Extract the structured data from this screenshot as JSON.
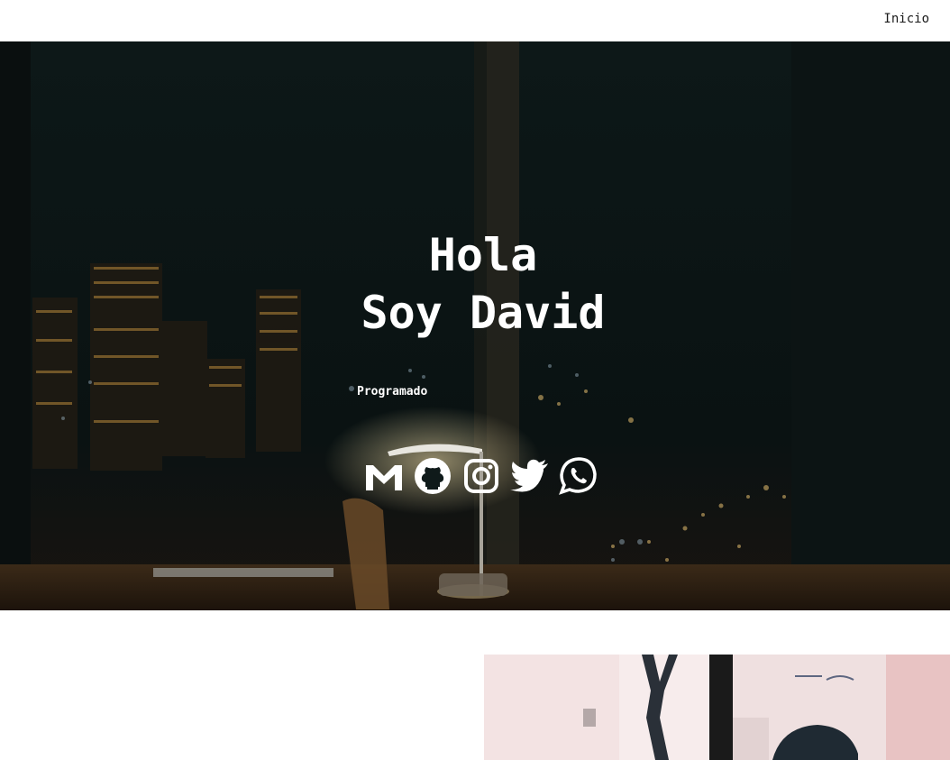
{
  "nav": {
    "home_label": "Inicio"
  },
  "hero": {
    "title_line1": "Hola",
    "title_line2": "Soy David",
    "subtitle": "Programado",
    "social_icons": [
      "gmail-icon",
      "github-icon",
      "instagram-icon",
      "twitter-icon",
      "whatsapp-icon"
    ]
  },
  "colors": {
    "hero_background": "#0f1a1a",
    "text_on_hero": "#ffffff",
    "page_background": "#ffffff"
  }
}
